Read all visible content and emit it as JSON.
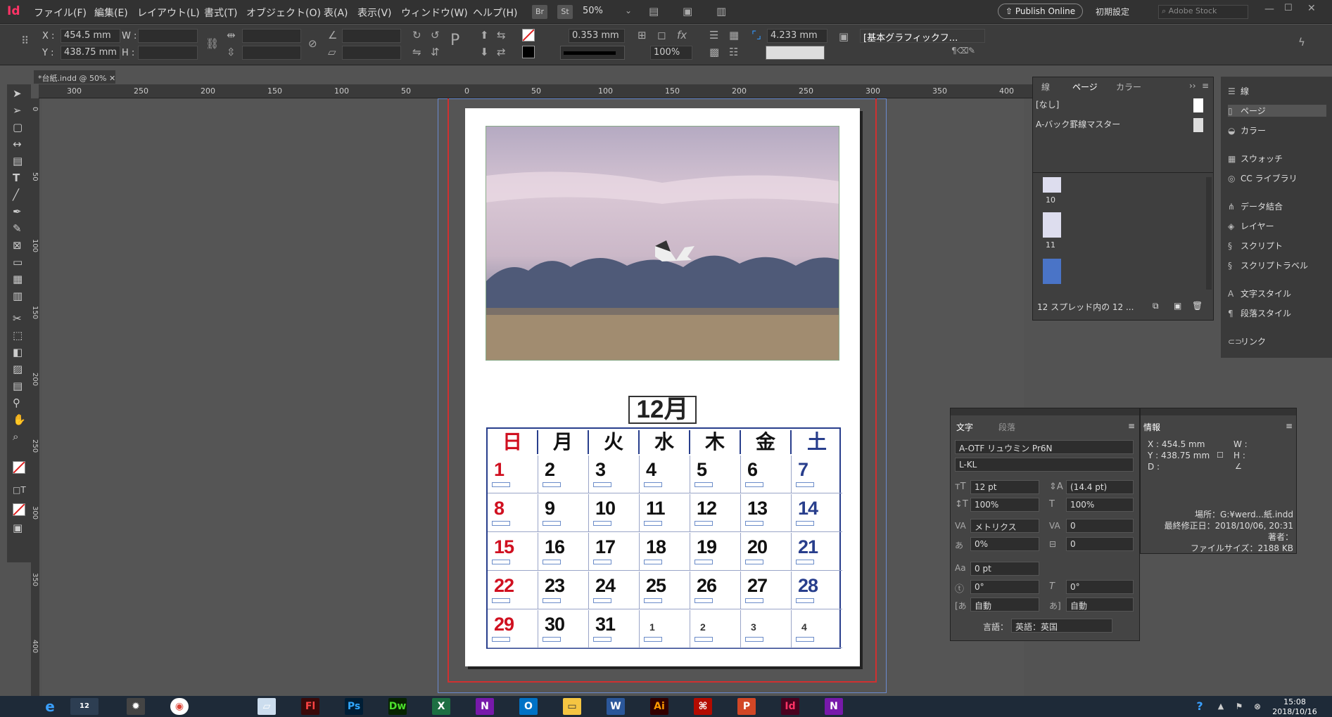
{
  "app": {
    "logo": "Id"
  },
  "menu": [
    "ファイル(F)",
    "編集(E)",
    "レイアウト(L)",
    "書式(T)",
    "オブジェクト(O)",
    "表(A)",
    "表示(V)",
    "ウィンドウ(W)",
    "ヘルプ(H)"
  ],
  "menubar": {
    "br": "Br",
    "st": "St",
    "zoom": "50%",
    "publish": "Publish Online",
    "workspace": "初期設定",
    "stock_placeholder": "Adobe Stock"
  },
  "control": {
    "x_label": "X :",
    "x": "454.5 mm",
    "y_label": "Y :",
    "y": "438.75 mm",
    "w_label": "W :",
    "h_label": "H :",
    "stroke_weight": "0.353 mm",
    "scale": "100%",
    "offset": "4.233 mm",
    "style": "[基本グラフィックフ..."
  },
  "document": {
    "tab": "*台紙.indd @ 50%"
  },
  "ruler": {
    "top": [
      "300",
      "250",
      "200",
      "150",
      "100",
      "50",
      "0",
      "50",
      "100",
      "150",
      "200",
      "250",
      "300",
      "350",
      "400"
    ],
    "left": [
      "0",
      "50",
      "100",
      "150",
      "200",
      "250",
      "300",
      "350",
      "400"
    ]
  },
  "calendar": {
    "month": "12月",
    "weekdays": [
      "日",
      "月",
      "火",
      "水",
      "木",
      "金",
      "土"
    ],
    "weeks": [
      [
        "1",
        "2",
        "3",
        "4",
        "5",
        "6",
        "7"
      ],
      [
        "8",
        "9",
        "10",
        "11",
        "12",
        "13",
        "14"
      ],
      [
        "15",
        "16",
        "17",
        "18",
        "19",
        "20",
        "21"
      ],
      [
        "22",
        "23",
        "24",
        "25",
        "26",
        "27",
        "28"
      ],
      [
        "29",
        "30",
        "31",
        "1",
        "2",
        "3",
        "4"
      ]
    ]
  },
  "pages_panel": {
    "tabs": [
      "線",
      "ページ",
      "カラー"
    ],
    "masters": [
      "[なし]",
      "A-バック罫線マスター"
    ],
    "thumbs": [
      "10",
      "11"
    ],
    "footer": "12 スプレッド内の 12 ..."
  },
  "dock": [
    "線",
    "ページ",
    "カラー",
    "スウォッチ",
    "CC ライブラリ",
    "データ結合",
    "レイヤー",
    "スクリプト",
    "スクリプトラベル",
    "文字スタイル",
    "段落スタイル",
    "リンク"
  ],
  "char_panel": {
    "tabs": [
      "文字",
      "段落"
    ],
    "font": "A-OTF リュウミン Pr6N",
    "style": "L-KL",
    "size": "12 pt",
    "leading": "(14.4 pt)",
    "vscale": "100%",
    "hscale": "100%",
    "kerning": "メトリクス",
    "tracking": "0",
    "tsume": "0%",
    "aki": "0",
    "baseline": "0 pt",
    "rotate": "0°",
    "skew": "0°",
    "mojigumi1": "自動",
    "mojigumi2": "自動",
    "lang_label": "言語：",
    "lang": "英語：英国"
  },
  "info_panel": {
    "title": "情報",
    "x": "X : 454.5 mm",
    "y": "Y : 438.75 mm",
    "d": "D :",
    "w": "W :",
    "h": "H :",
    "location": "場所：G:¥werd...紙.indd",
    "modified": "最終修正日：2018/10/06, 20:31",
    "author": "著者：",
    "filesize": "ファイルサイズ：2188 KB"
  },
  "taskbar": {
    "time": "15:08",
    "date": "2018/10/16",
    "apps": [
      "Fl",
      "Ps",
      "Dw",
      "X",
      "N",
      "O",
      "W",
      "Ai",
      "P",
      "Id",
      "N"
    ],
    "count": "12"
  },
  "colors": {
    "indesign": "#ff3366",
    "calendar_border": "#283e8c",
    "sunday": "#d01020",
    "saturday": "#283e8c"
  }
}
